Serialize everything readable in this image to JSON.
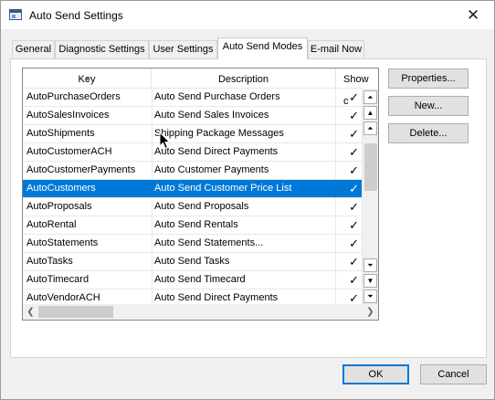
{
  "window": {
    "title": "Auto Send Settings",
    "close_glyph": "✕"
  },
  "tabs": [
    {
      "label": "General"
    },
    {
      "label": "Diagnostic Settings"
    },
    {
      "label": "User Settings"
    },
    {
      "label": "Auto Send Modes",
      "active": true
    },
    {
      "label": "E-mail Now"
    }
  ],
  "list": {
    "columns": {
      "key": "Key",
      "description": "Description",
      "show": "Show c"
    },
    "sort_indicator": "▼",
    "check_glyph": "✓",
    "rows": [
      {
        "key": "AutoPurchaseOrders",
        "description": "Auto Send Purchase Orders",
        "checked": true
      },
      {
        "key": "AutoSalesInvoices",
        "description": "Auto Send Sales Invoices",
        "checked": true
      },
      {
        "key": "AutoShipments",
        "description": "Shipping Package Messages",
        "checked": true
      },
      {
        "key": "AutoCustomerACH",
        "description": "Auto Send Direct Payments",
        "checked": true
      },
      {
        "key": "AutoCustomerPayments",
        "description": "Auto Customer Payments",
        "checked": true
      },
      {
        "key": "AutoCustomers",
        "description": "Auto Send Customer Price List",
        "checked": true,
        "selected": true
      },
      {
        "key": "AutoProposals",
        "description": "Auto Send Proposals",
        "checked": true
      },
      {
        "key": "AutoRental",
        "description": "Auto Send Rentals",
        "checked": true
      },
      {
        "key": "AutoStatements",
        "description": "Auto Send Statements...",
        "checked": true
      },
      {
        "key": "AutoTasks",
        "description": "Auto Send Tasks",
        "checked": true
      },
      {
        "key": "AutoTimecard",
        "description": "Auto Send Timecard",
        "checked": true
      },
      {
        "key": "AutoVendorACH",
        "description": "Auto Send Direct Payments",
        "checked": true
      }
    ],
    "scroll_glyphs": {
      "top": "⏶",
      "up": "▲",
      "down": "▼",
      "bottom": "⏷",
      "left": "❮",
      "right": "❯"
    }
  },
  "side_buttons": {
    "properties": "Properties...",
    "new": "New...",
    "delete": "Delete..."
  },
  "footer": {
    "ok": "OK",
    "cancel": "Cancel"
  },
  "colors": {
    "selection": "#0078d7",
    "default_button_border": "#0078d7"
  }
}
